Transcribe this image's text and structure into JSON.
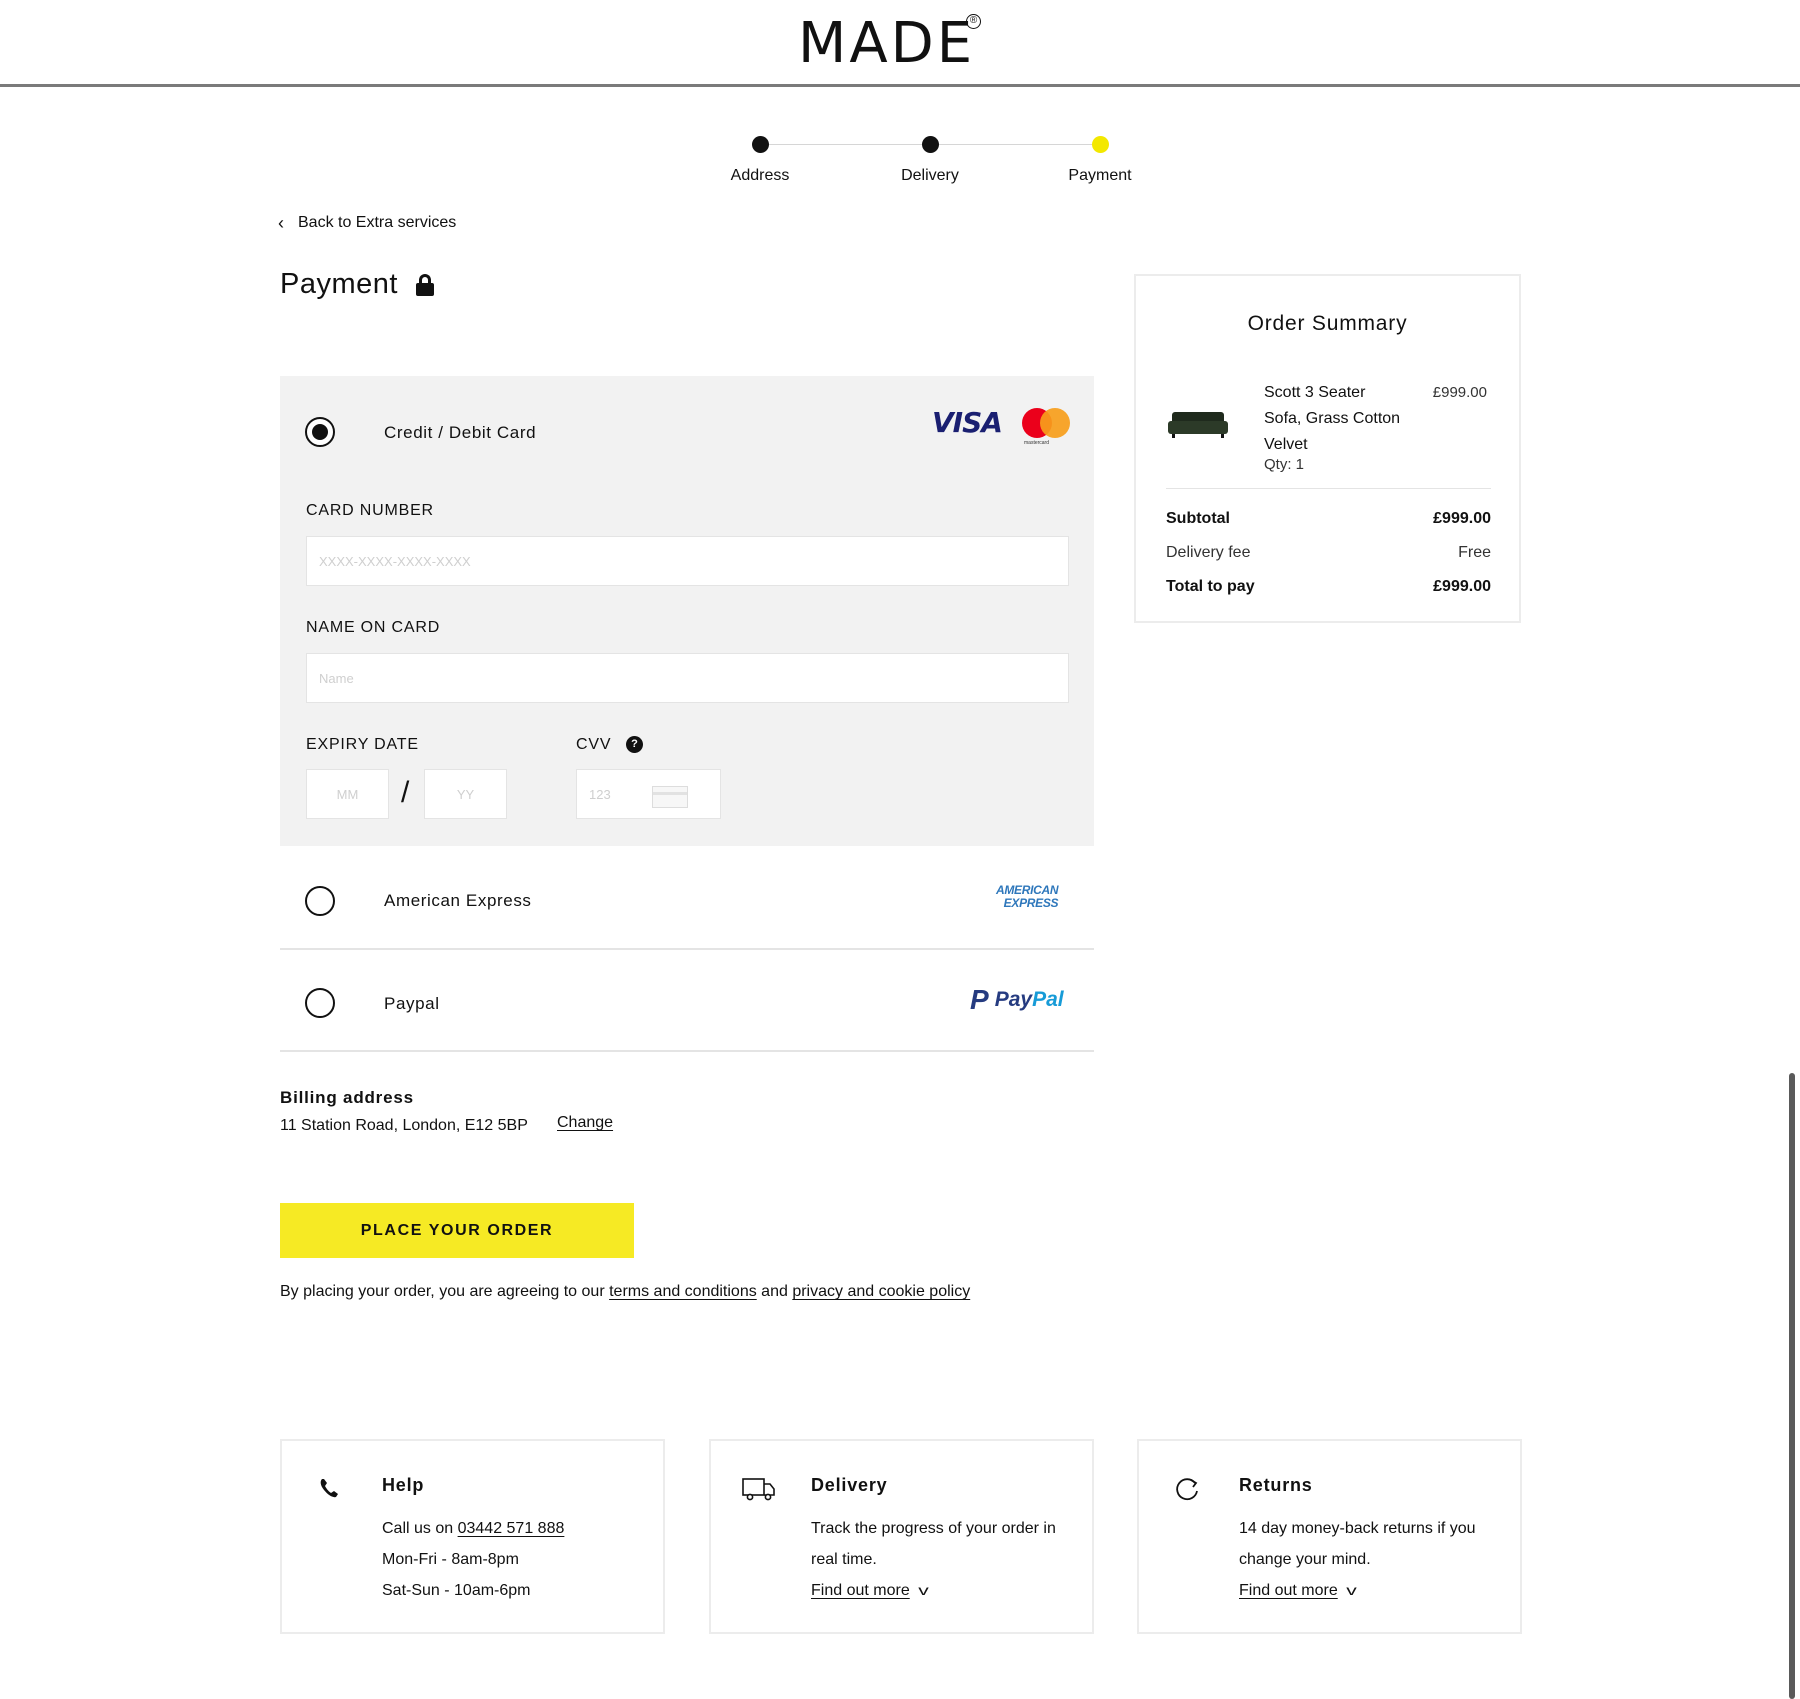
{
  "brand": {
    "logo": "MADE",
    "reg": "®"
  },
  "stepper": {
    "steps": [
      {
        "label": "Address",
        "state": "done"
      },
      {
        "label": "Delivery",
        "state": "done"
      },
      {
        "label": "Payment",
        "state": "active"
      }
    ]
  },
  "back_link": {
    "icon": "chevron-left-icon",
    "label": "Back to Extra services"
  },
  "page_title": "Payment",
  "payment": {
    "methods": [
      {
        "label": "Credit / Debit Card",
        "selected": true
      },
      {
        "label": "American Express",
        "selected": false
      },
      {
        "label": "Paypal",
        "selected": false
      }
    ],
    "logos": {
      "visa": "VISA",
      "mastercard_text": "mastercard",
      "amex_line1": "AMERICAN",
      "amex_line2": "EXPRESS",
      "paypal_pay": "Pay",
      "paypal_pal": "Pal",
      "paypal_p": "P"
    },
    "card_number": {
      "label": "CARD NUMBER",
      "placeholder": "XXXX-XXXX-XXXX-XXXX",
      "value": ""
    },
    "name_on_card": {
      "label": "NAME ON CARD",
      "placeholder": "Name",
      "value": ""
    },
    "expiry": {
      "label": "EXPIRY DATE",
      "month_placeholder": "MM",
      "year_placeholder": "YY",
      "separator": "/"
    },
    "cvv": {
      "label": "CVV",
      "placeholder": "123",
      "help": "?"
    }
  },
  "billing": {
    "title": "Billing address",
    "address": "11 Station Road, London, E12 5BP",
    "change_label": "Change"
  },
  "place_order_label": "PLACE YOUR ORDER",
  "legal": {
    "prefix": "By placing your order, you are agreeing to our ",
    "terms": "terms and conditions",
    "and": " and ",
    "privacy": "privacy and cookie policy"
  },
  "summary": {
    "title": "Order Summary",
    "item": {
      "name": "Scott 3 Seater Sofa, Grass Cotton Velvet",
      "qty": "Qty: 1",
      "price": "£999.00"
    },
    "rows": [
      {
        "label": "Subtotal",
        "value": "£999.00"
      },
      {
        "label": "Delivery fee",
        "value": "Free"
      },
      {
        "label": "Total to pay",
        "value": "£999.00"
      }
    ]
  },
  "info": {
    "help": {
      "title": "Help",
      "call_prefix": "Call us on ",
      "phone": "03442 571 888",
      "line2": "Mon-Fri - 8am-8pm",
      "line3": "Sat-Sun - 10am-6pm",
      "icon": "phone-icon"
    },
    "delivery": {
      "title": "Delivery",
      "text": "Track the progress of your order in real time.",
      "link": "Find out more",
      "icon": "truck-icon"
    },
    "returns": {
      "title": "Returns",
      "text": "14 day money-back returns if you change your mind.",
      "link": "Find out more",
      "icon": "refresh-icon"
    }
  },
  "colors": {
    "accent_yellow": "#f6ea24",
    "panel_grey": "#f2f2f2"
  }
}
